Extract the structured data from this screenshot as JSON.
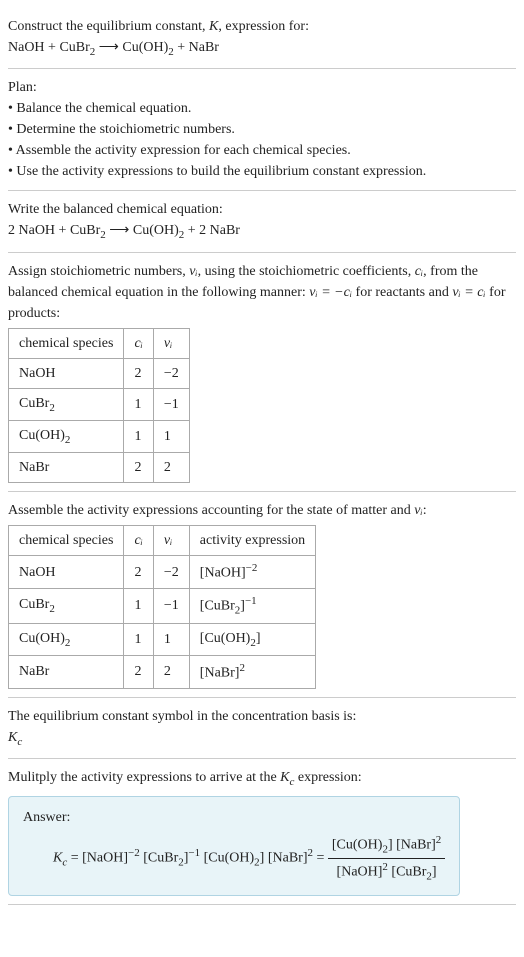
{
  "header": {
    "line1": "Construct the equilibrium constant, ",
    "k": "K",
    "line1b": ", expression for:",
    "equation_lhs": "NaOH + CuBr",
    "equation_rhs": "Cu(OH)",
    "equation_plus": " + NaBr",
    "arrow": " ⟶ "
  },
  "plan": {
    "title": "Plan:",
    "b1": "• Balance the chemical equation.",
    "b2": "• Determine the stoichiometric numbers.",
    "b3": "• Assemble the activity expression for each chemical species.",
    "b4": "• Use the activity expressions to build the equilibrium constant expression."
  },
  "balanced": {
    "title": "Write the balanced chemical equation:",
    "eq_a": "2 NaOH + CuBr",
    "eq_b": "Cu(OH)",
    "eq_c": " + 2 NaBr",
    "arrow": " ⟶ "
  },
  "stoich": {
    "intro_a": "Assign stoichiometric numbers, ",
    "nu_i": "νᵢ",
    "intro_b": ", using the stoichiometric coefficients, ",
    "c_i": "cᵢ",
    "intro_c": ", from the balanced chemical equation in the following manner: ",
    "rel1": "νᵢ = −cᵢ",
    "intro_d": " for reactants and ",
    "rel2": "νᵢ = cᵢ",
    "intro_e": " for products:",
    "headers": [
      "chemical species",
      "cᵢ",
      "νᵢ"
    ],
    "rows": [
      {
        "sp": "NaOH",
        "c": "2",
        "nu": "−2"
      },
      {
        "sp": "CuBr",
        "sub": "2",
        "c": "1",
        "nu": "−1"
      },
      {
        "sp": "Cu(OH)",
        "sub": "2",
        "c": "1",
        "nu": "1"
      },
      {
        "sp": "NaBr",
        "c": "2",
        "nu": "2"
      }
    ]
  },
  "activity": {
    "title_a": "Assemble the activity expressions accounting for the state of matter and ",
    "nu_i": "νᵢ",
    "title_b": ":",
    "headers": [
      "chemical species",
      "cᵢ",
      "νᵢ",
      "activity expression"
    ],
    "rows": [
      {
        "sp": "NaOH",
        "c": "2",
        "nu": "−2",
        "ae_base": "[NaOH]",
        "ae_exp": "−2"
      },
      {
        "sp": "CuBr",
        "sub": "2",
        "c": "1",
        "nu": "−1",
        "ae_base": "[CuBr",
        "ae_sub": "2",
        "ae_close": "]",
        "ae_exp": "−1"
      },
      {
        "sp": "Cu(OH)",
        "sub": "2",
        "c": "1",
        "nu": "1",
        "ae_base": "[Cu(OH)",
        "ae_sub": "2",
        "ae_close": "]"
      },
      {
        "sp": "NaBr",
        "c": "2",
        "nu": "2",
        "ae_base": "[NaBr]",
        "ae_exp": "2"
      }
    ]
  },
  "symbol": {
    "line": "The equilibrium constant symbol in the concentration basis is:",
    "kc": "K",
    "c": "c"
  },
  "final": {
    "title_a": "Mulitply the activity expressions to arrive at the ",
    "kc": "K",
    "c": "c",
    "title_b": " expression:",
    "answer_label": "Answer:",
    "lhs_k": "K",
    "lhs_c": "c",
    "eq": " = ",
    "t1": "[NaOH]",
    "e1": "−2",
    "t2": " [CuBr",
    "s2": "2",
    "t2b": "]",
    "e2": "−1",
    "t3": " [Cu(OH)",
    "s3": "2",
    "t3b": "] [NaBr]",
    "e4": "2",
    "eq2": " = ",
    "num_a": "[Cu(OH)",
    "num_s": "2",
    "num_b": "] [NaBr]",
    "num_e": "2",
    "den_a": "[NaOH]",
    "den_e": "2",
    "den_b": " [CuBr",
    "den_s": "2",
    "den_c": "]"
  }
}
